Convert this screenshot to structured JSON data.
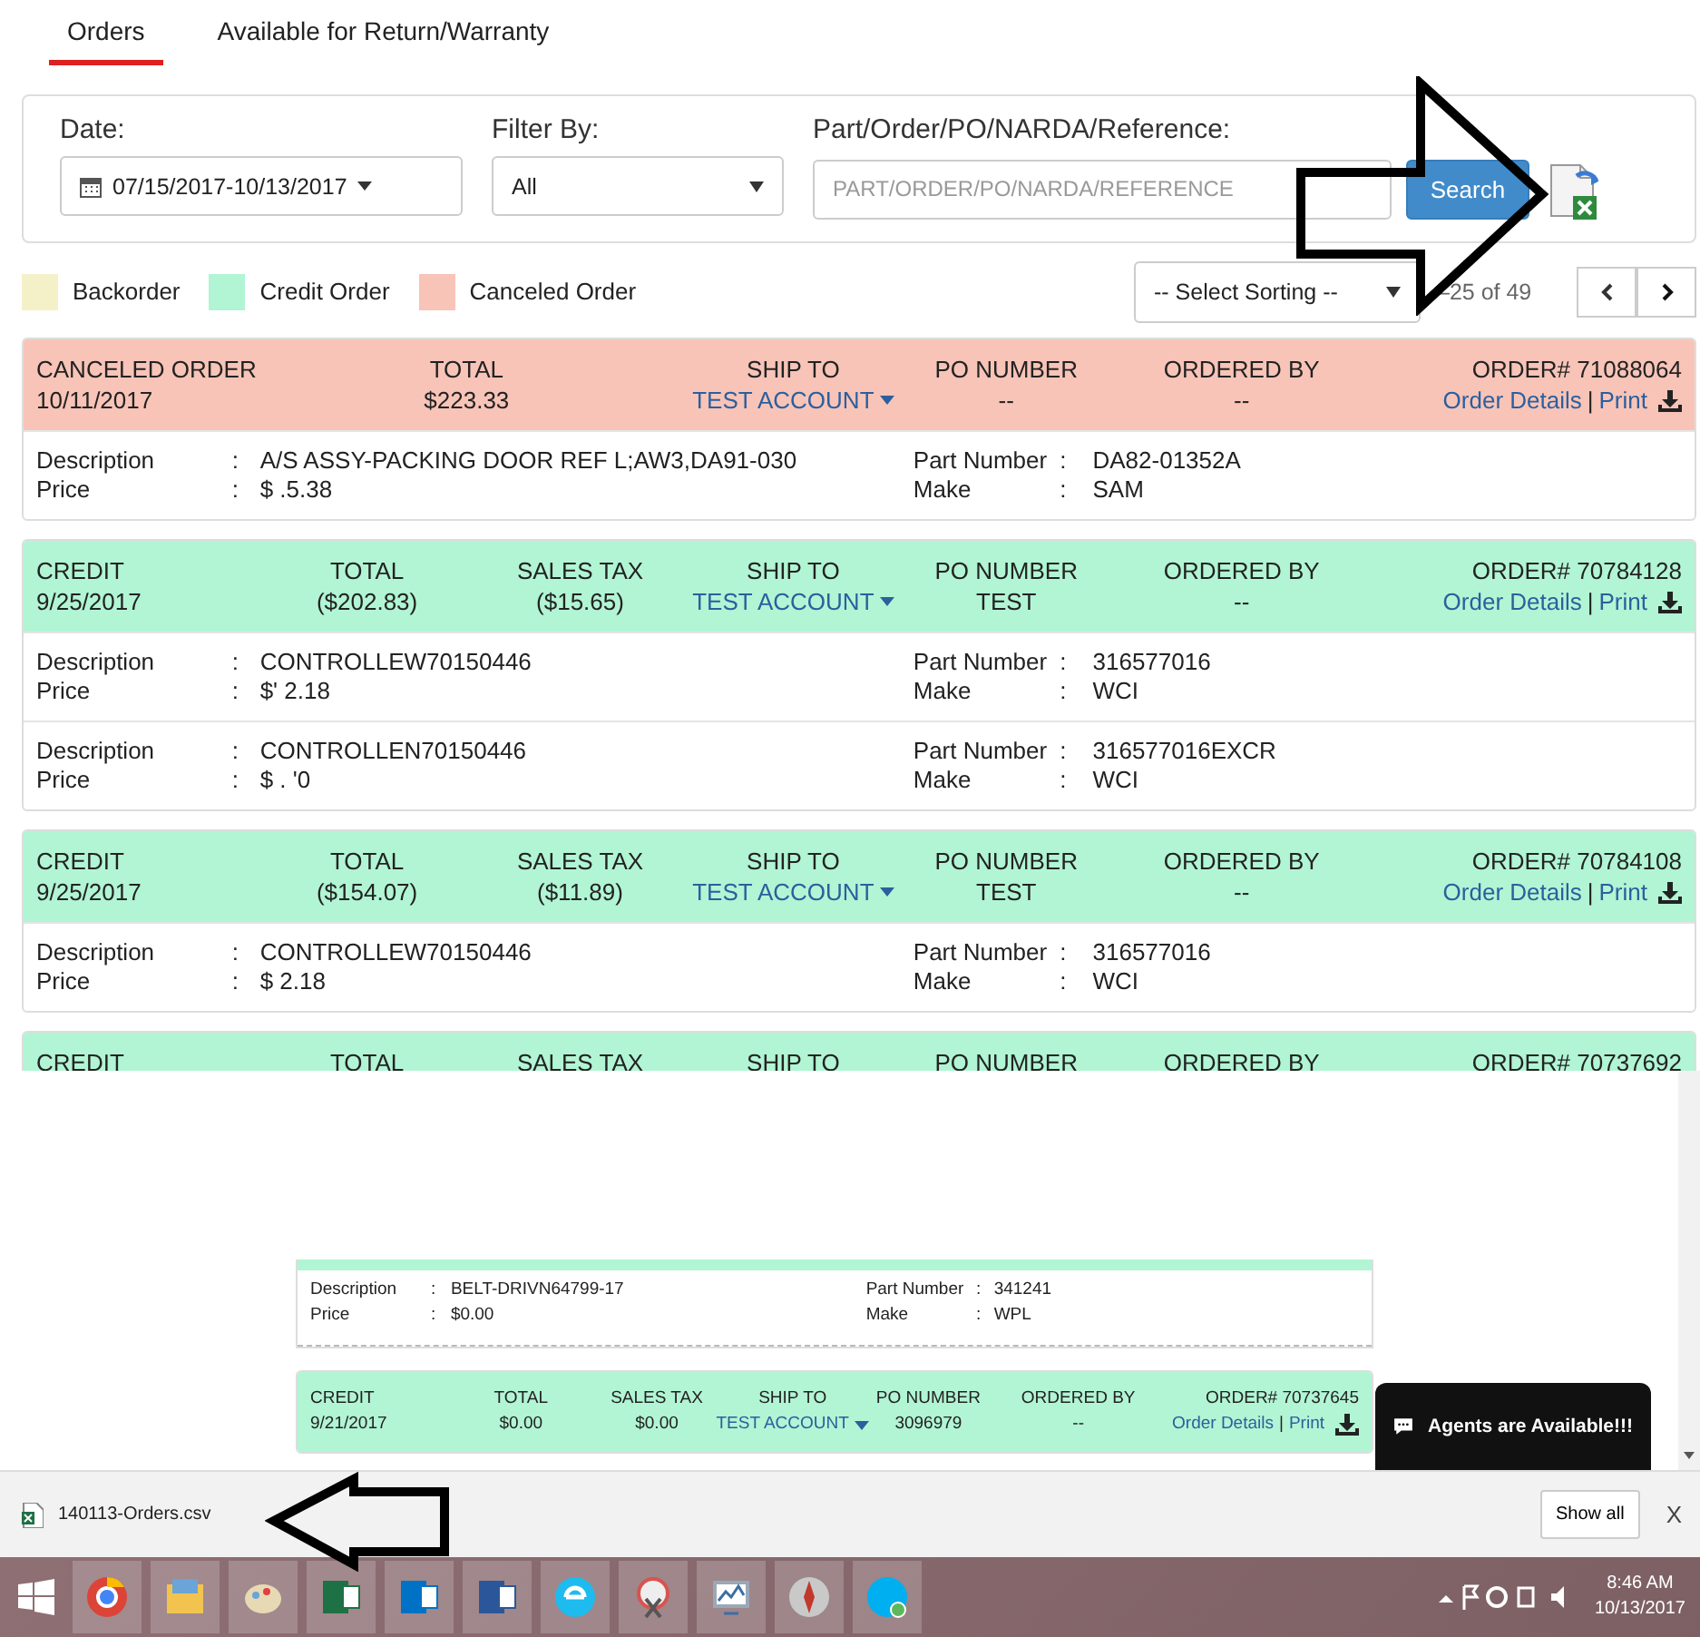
{
  "tabs": [
    {
      "label": "Orders",
      "selected": true
    },
    {
      "label": "Available for Return/Warranty",
      "selected": false
    }
  ],
  "filters": {
    "date": {
      "label": "Date:",
      "value": "07/15/2017-10/13/2017"
    },
    "filter_by": {
      "label": "Filter By:",
      "value": "All"
    },
    "search": {
      "label": "Part/Order/PO/NARDA/Reference:",
      "placeholder": "PART/ORDER/PO/NARDA/REFERENCE"
    },
    "search_button": "Search"
  },
  "legend": [
    {
      "label": "Backorder",
      "color": "#f4f1c9"
    },
    {
      "label": "Credit Order",
      "color": "#b1f5d4"
    },
    {
      "label": "Canceled Order",
      "color": "#f8c4b8"
    }
  ],
  "sorting": {
    "placeholder": "-- Select Sorting --"
  },
  "pagination": {
    "range": "–25 of 49"
  },
  "orders": [
    {
      "kind": "canceled",
      "status": "CANCELED ORDER",
      "date": "10/11/2017",
      "fields": [
        {
          "kind": "total",
          "label": "TOTAL",
          "value": "$223.33"
        },
        {
          "kind": "ship_to",
          "label": "SHIP TO",
          "value": "TEST ACCOUNT"
        },
        {
          "kind": "po",
          "label": "PO NUMBER",
          "value": "--"
        },
        {
          "kind": "ordered_by",
          "label": "ORDERED BY",
          "value": "--"
        }
      ],
      "order_no": "ORDER# 71088064",
      "details_link": "Order Details",
      "separator": "|",
      "print_link": "Print",
      "items": [
        {
          "description_label": "Description",
          "description_colon": ":",
          "description": "A/S ASSY-PACKING DOOR REF L;AW3,DA91-030",
          "price_label": "Price",
          "price_colon": ":",
          "part_colon": ":",
          "make_colon": ":",
          "price": "$ .5.38",
          "part_label": "Part Number",
          "part_number": "DA82-01352A",
          "make_label": "Make",
          "make": "SAM"
        }
      ]
    },
    {
      "kind": "credit",
      "status": "CREDIT",
      "date": "9/25/2017",
      "fields": [
        {
          "kind": "total",
          "label": "TOTAL",
          "value": "($202.83)"
        },
        {
          "kind": "tax",
          "label": "SALES TAX",
          "value": "($15.65)"
        },
        {
          "kind": "ship_to",
          "label": "SHIP TO",
          "value": "TEST ACCOUNT"
        },
        {
          "kind": "po",
          "label": "PO NUMBER",
          "value": "TEST"
        },
        {
          "kind": "ordered_by",
          "label": "ORDERED BY",
          "value": "--"
        }
      ],
      "order_no": "ORDER# 70784128",
      "details_link": "Order Details",
      "separator": "|",
      "print_link": "Print",
      "items": [
        {
          "description_label": "Description",
          "description_colon": ":",
          "description": "CONTROLLEW70150446",
          "price_label": "Price",
          "price_colon": ":",
          "part_colon": ":",
          "make_colon": ":",
          "price": "$' 2.18",
          "part_label": "Part Number",
          "part_number": "316577016",
          "make_label": "Make",
          "make": "WCI"
        },
        {
          "description_label": "Description",
          "description_colon": ":",
          "description": "CONTROLLEN70150446",
          "price_label": "Price",
          "price_colon": ":",
          "part_colon": ":",
          "make_colon": ":",
          "price": "$ . '0",
          "part_label": "Part Number",
          "part_number": "316577016EXCR",
          "make_label": "Make",
          "make": "WCI"
        }
      ]
    },
    {
      "kind": "credit",
      "status": "CREDIT",
      "date": "9/25/2017",
      "fields": [
        {
          "kind": "total",
          "label": "TOTAL",
          "value": "($154.07)"
        },
        {
          "kind": "tax",
          "label": "SALES TAX",
          "value": "($11.89)"
        },
        {
          "kind": "ship_to",
          "label": "SHIP TO",
          "value": "TEST ACCOUNT"
        },
        {
          "kind": "po",
          "label": "PO NUMBER",
          "value": "TEST"
        },
        {
          "kind": "ordered_by",
          "label": "ORDERED BY",
          "value": "--"
        }
      ],
      "order_no": "ORDER# 70784108",
      "details_link": "Order Details",
      "separator": "|",
      "print_link": "Print",
      "items": [
        {
          "description_label": "Description",
          "description_colon": ":",
          "description": "CONTROLLEW70150446",
          "price_label": "Price",
          "price_colon": ":",
          "part_colon": ":",
          "make_colon": ":",
          "price": "$ 2.18",
          "part_label": "Part Number",
          "part_number": "316577016",
          "make_label": "Make",
          "make": "WCI"
        }
      ]
    },
    {
      "kind": "credit",
      "status": "CREDIT",
      "fields": [
        {
          "kind": "total",
          "label": "TOTAL"
        },
        {
          "kind": "tax",
          "label": "SALES TAX"
        },
        {
          "kind": "ship_to",
          "label": "SHIP TO"
        },
        {
          "kind": "po",
          "label": "PO NUMBER"
        },
        {
          "kind": "ordered_by",
          "label": "ORDERED BY"
        }
      ],
      "order_no": "ORDER# 70737692"
    }
  ],
  "lower_view": {
    "items": [
      {
        "description_label": "Description",
        "description_colon": ":",
        "description": "BELT-DRIVN64799-17",
        "price_label": "Price",
        "price_colon": ":",
        "part_colon": ":",
        "make_colon": ":",
        "price": "$0.00",
        "part_label": "Part Number",
        "part_number": "341241",
        "make_label": "Make",
        "make": "WPL"
      }
    ],
    "orders": [
      {
        "kind": "credit",
        "status": "CREDIT",
        "date": "9/21/2017",
        "fields": [
          {
            "kind": "total",
            "label": "TOTAL",
            "value": "$0.00"
          },
          {
            "kind": "tax",
            "label": "SALES TAX",
            "value": "$0.00"
          },
          {
            "kind": "ship_to",
            "label": "SHIP TO",
            "value": "TEST ACCOUNT"
          },
          {
            "kind": "po",
            "label": "PO NUMBER",
            "value": "3096979"
          },
          {
            "kind": "ordered_by",
            "label": "ORDERED BY",
            "value": "--"
          }
        ],
        "order_no": "ORDER# 70737645",
        "details_link": "Order Details",
        "separator": "|",
        "print_link": "Print"
      }
    ]
  },
  "chat": {
    "label": "Agents are Available!!!"
  },
  "download_bar": {
    "file": "140113-Orders.csv",
    "show_all": "Show all",
    "close": "X"
  },
  "taskbar": {
    "apps": [
      {
        "kind": "chrome"
      },
      {
        "kind": "folder"
      },
      {
        "kind": "paint"
      },
      {
        "kind": "excel"
      },
      {
        "kind": "outlook"
      },
      {
        "kind": "word"
      },
      {
        "kind": "ie"
      },
      {
        "kind": "snip"
      },
      {
        "kind": "monitor"
      },
      {
        "kind": "compass"
      },
      {
        "kind": "skype"
      }
    ],
    "time": "8:46 AM",
    "date": "10/13/2017"
  }
}
